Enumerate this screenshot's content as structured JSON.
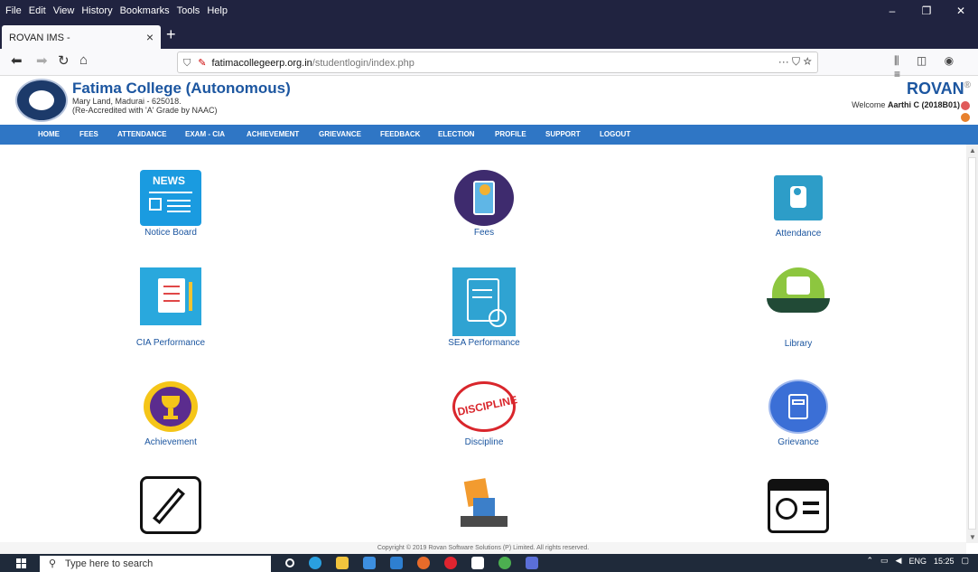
{
  "browser": {
    "menu": [
      "File",
      "Edit",
      "View",
      "History",
      "Bookmarks",
      "Tools",
      "Help"
    ],
    "tab_title": "ROVAN IMS -",
    "url_host": "fatimacollegeerp.org.in",
    "url_path": "/studentlogin/index.php",
    "url_actions": "···  ⛉  ☆",
    "toolbar_icons": [
      "library-icon",
      "sidebar-icon",
      "account-icon",
      "menu-icon"
    ]
  },
  "header": {
    "college": "Fatima College (Autonomous)",
    "address": "Mary Land, Madurai - 625018.",
    "accreditation": "(Re-Accredited with 'A' Grade by NAAC)",
    "brand": "ROVAN",
    "welcome_prefix": "Welcome",
    "user": "Aarthi C (2018B01)"
  },
  "nav": [
    "HOME",
    "FEES",
    "ATTENDANCE",
    "EXAM - CIA",
    "ACHIEVEMENT",
    "GRIEVANCE",
    "FEEDBACK",
    "ELECTION",
    "PROFILE",
    "SUPPORT",
    "LOGOUT"
  ],
  "tiles": [
    {
      "label": "Notice Board",
      "icon": "news-icon",
      "badge": "NEWS"
    },
    {
      "label": "Fees",
      "icon": "fees-icon"
    },
    {
      "label": "Attendance",
      "icon": "attendance-icon"
    },
    {
      "label": "CIA Performance",
      "icon": "cia-performance-icon"
    },
    {
      "label": "SEA Performance",
      "icon": "sea-performance-icon"
    },
    {
      "label": "Library",
      "icon": "library-book-icon"
    },
    {
      "label": "Achievement",
      "icon": "trophy-icon"
    },
    {
      "label": "Discipline",
      "icon": "discipline-stamp-icon",
      "badge": "DISCIPLINE"
    },
    {
      "label": "Grievance",
      "icon": "grievance-icon"
    }
  ],
  "footer": "Copyright © 2019 Rovan Software Solutions (P) Limited. All rights reserved.",
  "taskbar": {
    "search_placeholder": "Type here to search",
    "lang": "ENG",
    "time": "15:25"
  }
}
